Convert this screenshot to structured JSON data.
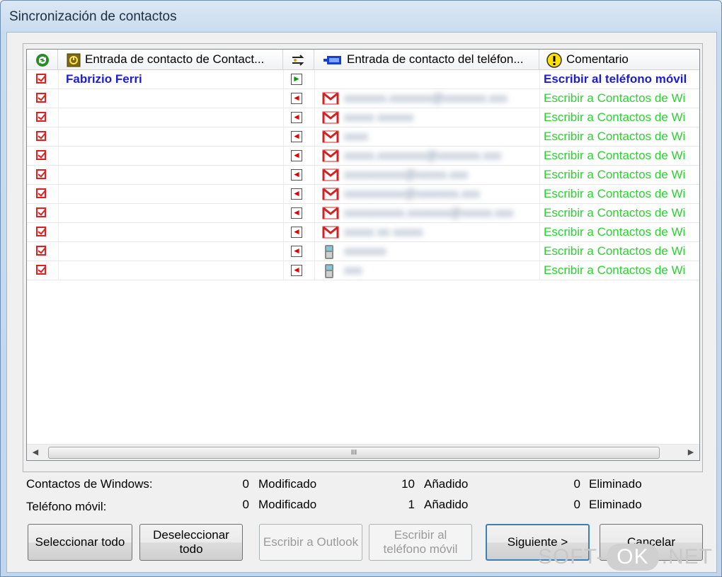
{
  "window": {
    "title": "Sincronización de contactos"
  },
  "list": {
    "columns": [
      {
        "label": "",
        "icon": "sync-icon"
      },
      {
        "label": "Entrada de contacto de Contact...",
        "icon": "windows-contacts-icon"
      },
      {
        "label": "",
        "icon": "direction-icon"
      },
      {
        "label": "Entrada de contacto del teléfon...",
        "icon": "phone-contacts-icon"
      },
      {
        "label": "Comentario",
        "icon": "warning-icon"
      }
    ],
    "rows": [
      {
        "windows_name": "Fabrizio Ferri",
        "direction": "right",
        "phone_type": "",
        "phone_entry": "",
        "comment": "Escribir al teléfono móvil",
        "comment_color": "#1c1cd6"
      },
      {
        "windows_name": "",
        "direction": "left",
        "phone_type": "gmail",
        "phone_entry": "xxxxxxx.xxxxxxx@xxxxxxx.xxx",
        "comment": "Escribir a Contactos de Wi",
        "comment_color": "#29d22f"
      },
      {
        "windows_name": "",
        "direction": "left",
        "phone_type": "gmail",
        "phone_entry": "xxxxx xxxxxx",
        "comment": "Escribir a Contactos de Wi",
        "comment_color": "#29d22f"
      },
      {
        "windows_name": "",
        "direction": "left",
        "phone_type": "gmail",
        "phone_entry": "xxxx",
        "comment": "Escribir a Contactos de Wi",
        "comment_color": "#29d22f"
      },
      {
        "windows_name": "",
        "direction": "left",
        "phone_type": "gmail",
        "phone_entry": "xxxxx.xxxxxxxx@xxxxxxx.xxx",
        "comment": "Escribir a Contactos de Wi",
        "comment_color": "#29d22f"
      },
      {
        "windows_name": "",
        "direction": "left",
        "phone_type": "gmail",
        "phone_entry": "xxxxxxxxxx@xxxxx.xxx",
        "comment": "Escribir a Contactos de Wi",
        "comment_color": "#29d22f"
      },
      {
        "windows_name": "",
        "direction": "left",
        "phone_type": "gmail",
        "phone_entry": "xxxxxxxxxx@xxxxxxx.xxx",
        "comment": "Escribir a Contactos de Wi",
        "comment_color": "#29d22f"
      },
      {
        "windows_name": "",
        "direction": "left",
        "phone_type": "gmail",
        "phone_entry": "xxxxxxxxxx.xxxxxxx@xxxxx.xxx",
        "comment": "Escribir a Contactos de Wi",
        "comment_color": "#29d22f"
      },
      {
        "windows_name": "",
        "direction": "left",
        "phone_type": "gmail",
        "phone_entry": "xxxxx xx xxxxx",
        "comment": "Escribir a Contactos de Wi",
        "comment_color": "#29d22f"
      },
      {
        "windows_name": "",
        "direction": "left",
        "phone_type": "phone",
        "phone_entry": "xxxxxxx",
        "comment": "Escribir a Contactos de Wi",
        "comment_color": "#29d22f"
      },
      {
        "windows_name": "",
        "direction": "left",
        "phone_type": "phone",
        "phone_entry": "xxx",
        "comment": "Escribir a Contactos de Wi",
        "comment_color": "#29d22f"
      }
    ],
    "scroll_thumb_label": "III"
  },
  "stats": {
    "windows": {
      "label": "Contactos de Windows:",
      "modified": "0",
      "modified_label": "Modificado",
      "added": "10",
      "added_label": "Añadido",
      "deleted": "0",
      "deleted_label": "Eliminado"
    },
    "phone": {
      "label": "Teléfono móvil:",
      "modified": "0",
      "modified_label": "Modificado",
      "added": "1",
      "added_label": "Añadido",
      "deleted": "0",
      "deleted_label": "Eliminado"
    }
  },
  "buttons": {
    "select_all": "Seleccionar todo",
    "deselect_all": "Deseleccionar todo",
    "write_outlook": "Escribir a Outlook",
    "write_phone": "Escribir al teléfono móvil",
    "next": "Siguiente >",
    "cancel": "Cancelar"
  },
  "watermark": {
    "part1": "SOFT-",
    "part2": "OK",
    "part3": ".NET"
  }
}
